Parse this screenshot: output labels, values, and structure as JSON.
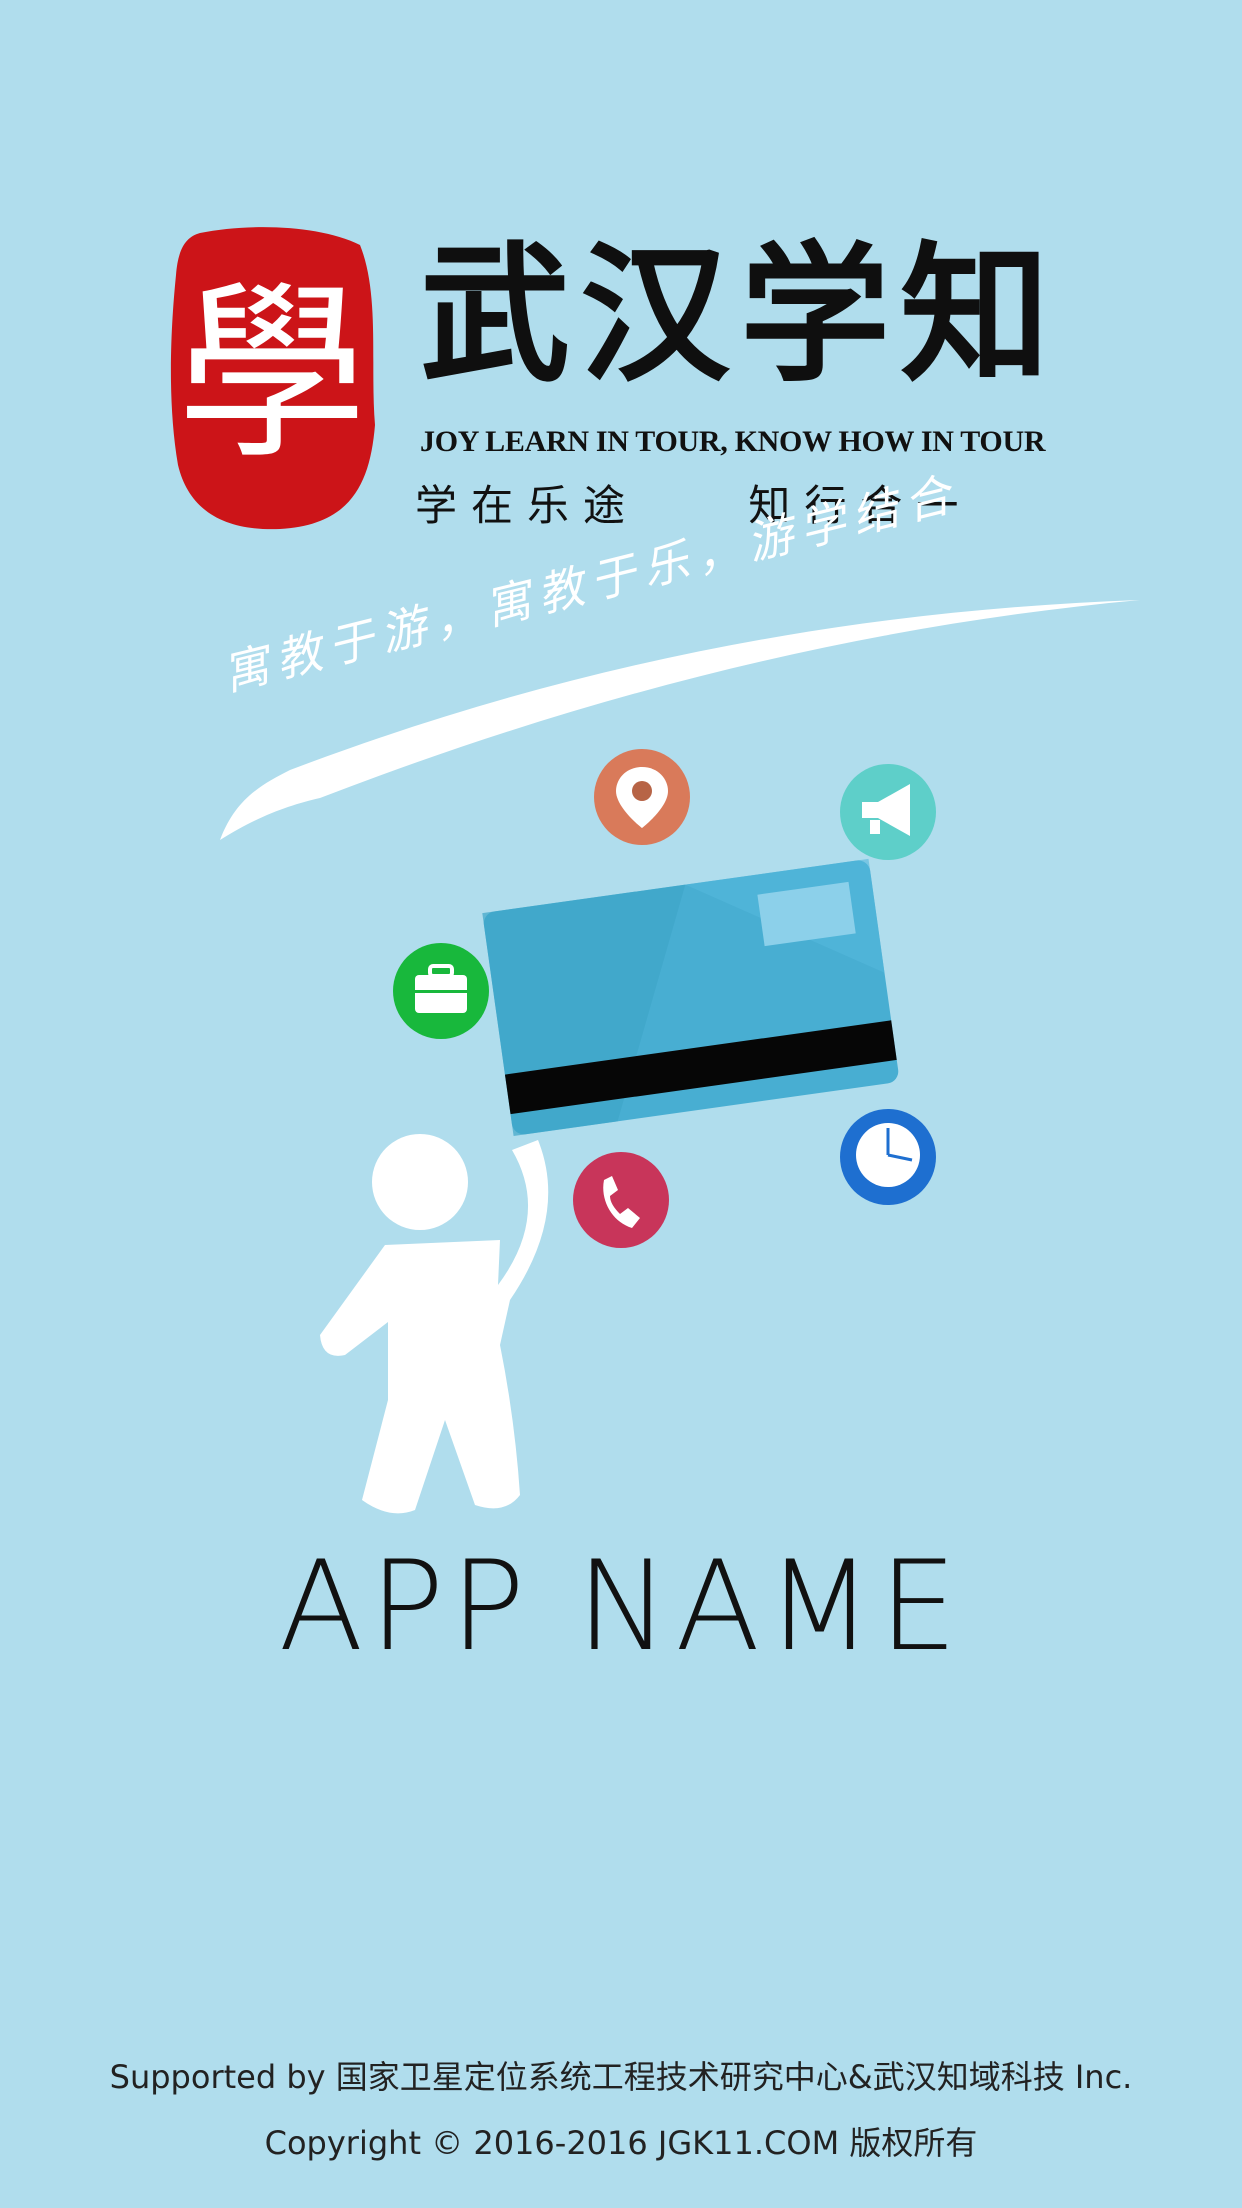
{
  "brand": {
    "seal_character": "學",
    "title_cn": "武汉学知",
    "tagline_en": "JOY LEARN IN TOUR, KNOW HOW IN TOUR",
    "tagline_cn": "学在乐途    知行合一",
    "slogan": "寓教于游，寓教于乐，游学结合"
  },
  "illustration": {
    "icons": [
      "location-pin-icon",
      "megaphone-icon",
      "briefcase-icon",
      "phone-icon",
      "clock-icon"
    ]
  },
  "app_name": "APP NAME",
  "footer": {
    "supported": "Supported by 国家卫星定位系统工程技术研究中心&武汉知域科技 Inc.",
    "copyright": "Copyright © 2016-2016 JGK11.COM 版权所有"
  },
  "colors": {
    "background": "#b0dded",
    "seal_red": "#cc1418",
    "card_blue": "#48aed2",
    "pin_orange": "#d97a5a",
    "megaphone_teal": "#5ecfc9",
    "briefcase_green": "#18b83c",
    "phone_red": "#c8355a",
    "clock_blue": "#1e6fd0"
  }
}
